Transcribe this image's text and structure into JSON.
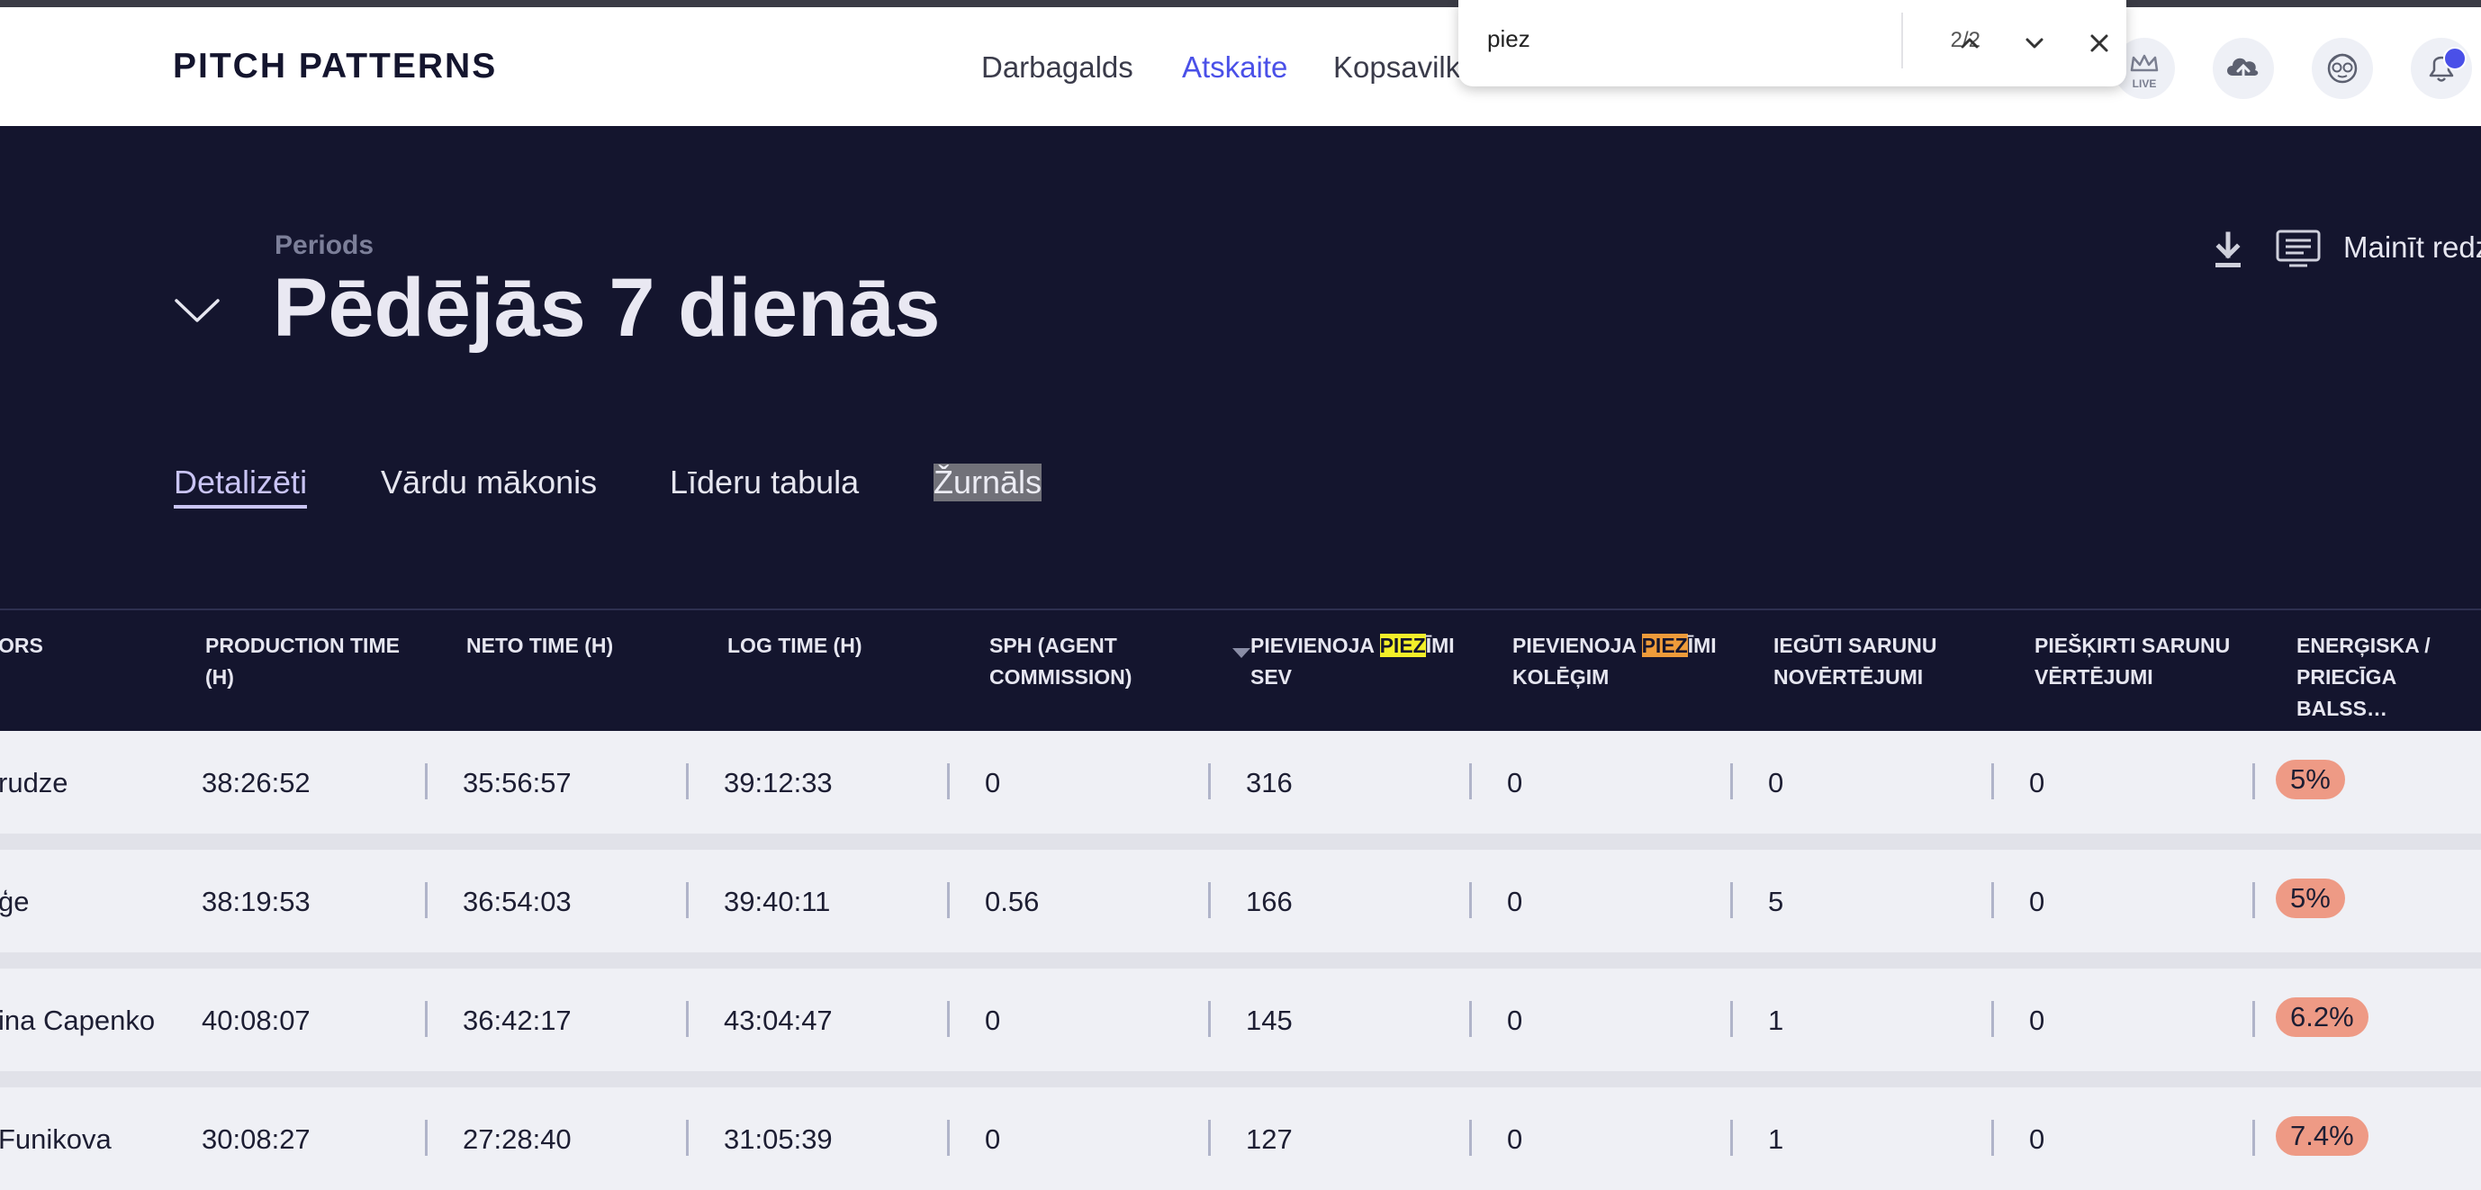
{
  "header": {
    "logo": "PITCH PATTERNS",
    "nav": [
      {
        "label": "Darbagalds",
        "active": false
      },
      {
        "label": "Atskaite",
        "active": true
      },
      {
        "label": "Kopsavilkums",
        "active": false
      }
    ],
    "live_label": "LIVE",
    "icons": [
      "crown-live-icon",
      "cloud-upload-icon",
      "avatar-icon",
      "bell-icon"
    ],
    "accent_color": "#4a50e8"
  },
  "find_bar": {
    "query": "piez",
    "count": "2/2",
    "icons": [
      "chevron-up-icon",
      "chevron-down-icon",
      "close-icon"
    ]
  },
  "period": {
    "label": "Periods",
    "title": "Pēdējās 7 dienās"
  },
  "toolbar": {
    "change_view_label": "Mainīt redz",
    "icons": [
      "download-icon",
      "screen-icon"
    ]
  },
  "tabs": [
    {
      "label": "Detalizēti",
      "active": true
    },
    {
      "label": "Vārdu mākonis",
      "active": false
    },
    {
      "label": "Līderu tabula",
      "active": false
    },
    {
      "label": "Žurnāls",
      "active": false,
      "find_highlight": true
    }
  ],
  "table": {
    "columns": [
      {
        "line1": "ORS",
        "line2": ""
      },
      {
        "line1": "PRODUCTION TIME",
        "line2": "(H)"
      },
      {
        "line1": "NETO TIME (H)",
        "line2": ""
      },
      {
        "line1": "LOG TIME (H)",
        "line2": ""
      },
      {
        "line1": "SPH (AGENT",
        "line2": "COMMISSION)"
      },
      {
        "line1_pre": "PIEVIENOJA ",
        "line1_hl": "PIEZ",
        "line1_post": "ĪMI",
        "line2": "SEV",
        "sorted": true
      },
      {
        "line1_pre": "PIEVIENOJA ",
        "line1_hl": "PIEZ",
        "line1_post": "ĪMI",
        "line2": "KOLĒĢIM"
      },
      {
        "line1": "IEGŪTI SARUNU",
        "line2": "NOVĒRTĒJUMI"
      },
      {
        "line1": "PIEŠĶIRTI SARUNU",
        "line2": "VĒRTĒJUMI"
      },
      {
        "line1": "ENERĢISKA /",
        "line2": "PRIECĪGA BALSS…"
      }
    ],
    "rows": [
      [
        "rudze",
        "38:26:52",
        "35:56:57",
        "39:12:33",
        "0",
        "316",
        "0",
        "0",
        "0",
        "5%"
      ],
      [
        "ģe",
        "38:19:53",
        "36:54:03",
        "39:40:11",
        "0.56",
        "166",
        "0",
        "5",
        "0",
        "5%"
      ],
      [
        "ina Capenko",
        "40:08:07",
        "36:42:17",
        "43:04:47",
        "0",
        "145",
        "0",
        "1",
        "0",
        "6.2%"
      ],
      [
        " Funikova",
        "30:08:27",
        "27:28:40",
        "31:05:39",
        "0",
        "127",
        "0",
        "1",
        "0",
        "7.4%"
      ]
    ],
    "badge_color": "#ee9a85"
  }
}
